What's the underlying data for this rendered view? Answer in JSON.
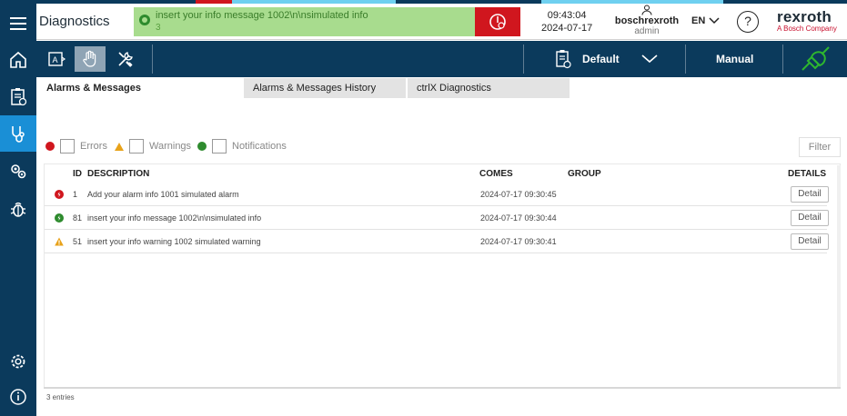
{
  "colors": {
    "sidebar_bg": "#0b3a5c",
    "sidebar_active": "#1a8fd6",
    "notification_bg": "#a8dc8e",
    "acknowledge_red": "#d0161e",
    "error": "#d0161e",
    "warning": "#e8a21a",
    "info": "#2e8b2e"
  },
  "sidebar": {
    "items": [
      {
        "icon": "home-icon"
      },
      {
        "icon": "clipboard-icon"
      },
      {
        "icon": "stethoscope-icon",
        "active": true
      },
      {
        "icon": "gears-icon"
      },
      {
        "icon": "bug-icon"
      },
      {
        "icon": "settings-icon"
      },
      {
        "icon": "info-icon"
      }
    ]
  },
  "header": {
    "title": "Diagnostics",
    "notification": {
      "text": "insert your info message 1002\\n\\nsimulated info",
      "count": "3"
    },
    "time": "09:43:04",
    "date": "2024-07-17",
    "user": {
      "name": "boschrexroth",
      "role": "admin"
    },
    "language": "EN",
    "help": "?",
    "brand": {
      "name": "rexroth",
      "subtitle": "A Bosch Company"
    }
  },
  "toolbar": {
    "profile": "Default",
    "mode": "Manual"
  },
  "tabs": [
    {
      "label": "Alarms & Messages",
      "active": true
    },
    {
      "label": "Alarms & Messages History",
      "active": false
    },
    {
      "label": "ctrlX Diagnostics",
      "active": false
    }
  ],
  "filters": {
    "errors": "Errors",
    "warnings": "Warnings",
    "notifications": "Notifications",
    "filter_button": "Filter"
  },
  "table": {
    "headers": {
      "id": "ID",
      "description": "DESCRIPTION",
      "comes": "COMES",
      "group": "GROUP",
      "details": "DETAILS"
    },
    "rows": [
      {
        "type": "error",
        "id": "1",
        "description": "Add your alarm info 1001 simulated alarm",
        "comes": "2024-07-17 09:30:45",
        "group": "",
        "detail": "Detail"
      },
      {
        "type": "info",
        "id": "81",
        "description": "insert your info message 1002\\n\\nsimulated info",
        "comes": "2024-07-17 09:30:44",
        "group": "",
        "detail": "Detail"
      },
      {
        "type": "warning",
        "id": "51",
        "description": "insert your info warning 1002 simulated warning",
        "comes": "2024-07-17 09:30:41",
        "group": "",
        "detail": "Detail"
      }
    ],
    "entries": "3 entries"
  }
}
